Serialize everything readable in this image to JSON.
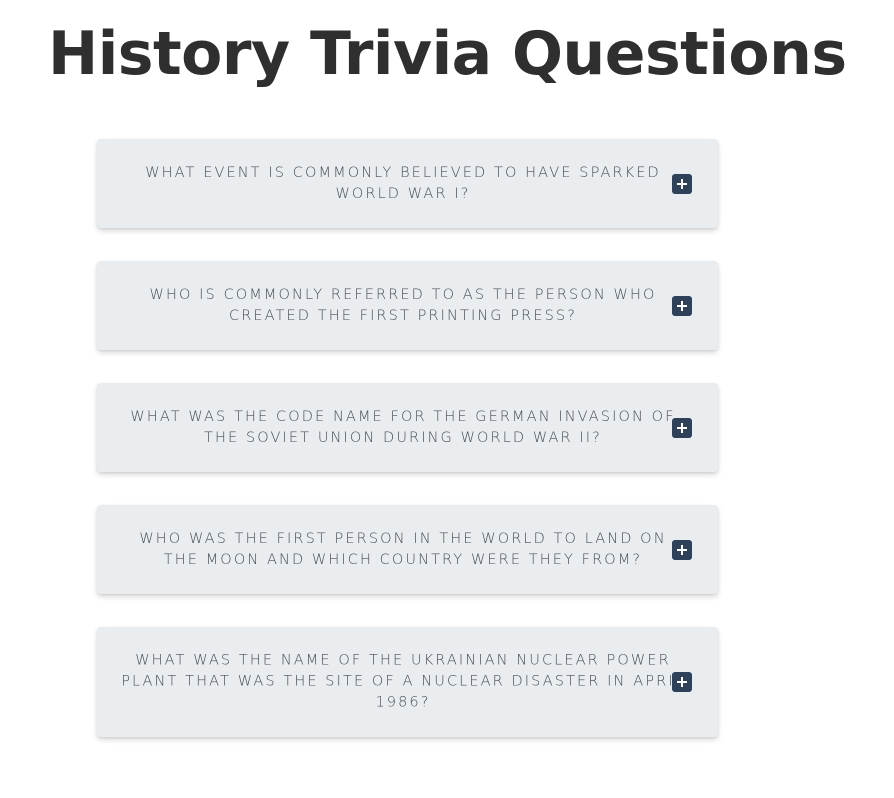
{
  "page": {
    "title": "History Trivia Questions"
  },
  "colors": {
    "card_background": "#e9edef",
    "toggle_background": "#2f4159",
    "title_text": "#2f2f2f",
    "question_text": "#4a4f55"
  },
  "faq": {
    "items": [
      {
        "question": "What event is commonly believed to have sparked World War I?",
        "icon": "plus-icon"
      },
      {
        "question": "Who is commonly referred to as the person who created the first printing press?",
        "icon": "plus-icon"
      },
      {
        "question": "What was the code name for the German invasion of the Soviet Union during World War II?",
        "icon": "plus-icon"
      },
      {
        "question": "Who was the first person in the world to land on the moon and which country were they from?",
        "icon": "plus-icon"
      },
      {
        "question": "What was the name of the Ukrainian nuclear power plant that was the site of a nuclear disaster in April 1986?",
        "icon": "plus-icon"
      }
    ]
  }
}
